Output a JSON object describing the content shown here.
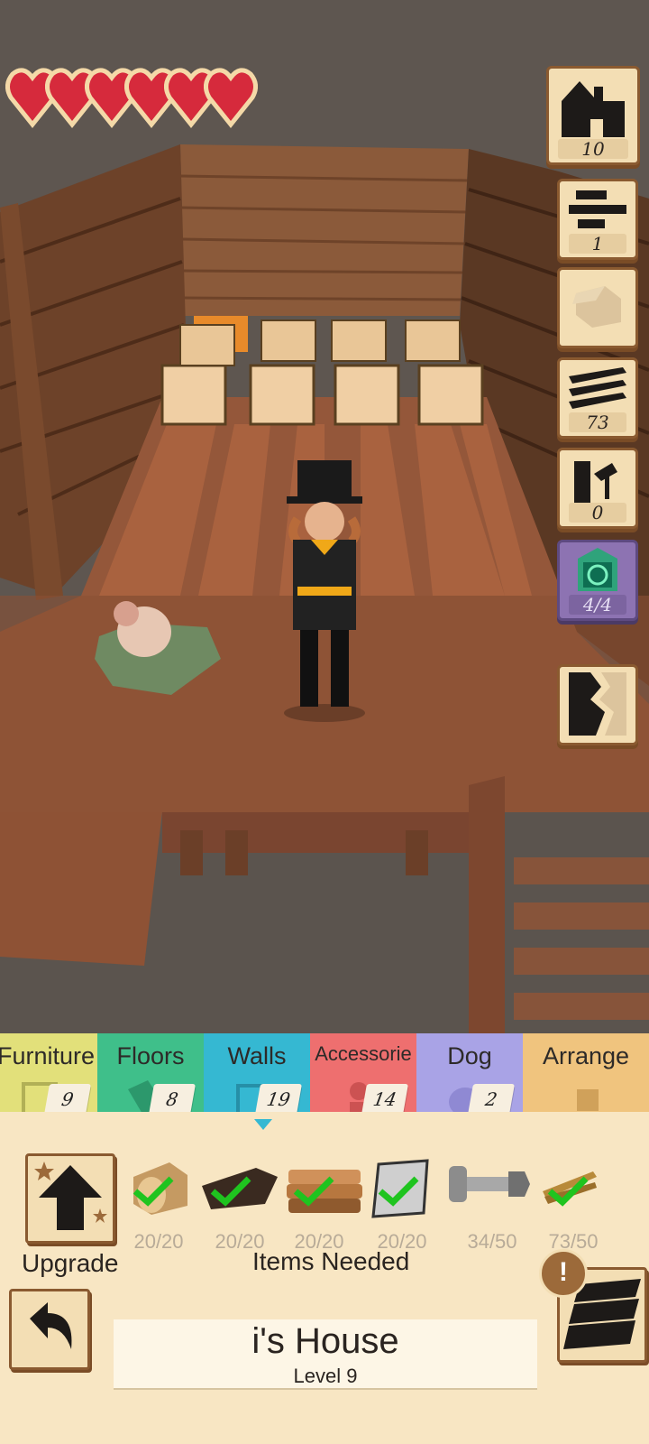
{
  "hearts": {
    "count": 6,
    "color": "#d62a3c"
  },
  "side_buttons": [
    {
      "name": "house",
      "icon": "house-icon",
      "count": "10"
    },
    {
      "name": "walls",
      "icon": "wall-pieces-icon",
      "count": "1"
    },
    {
      "name": "box",
      "icon": "box-icon",
      "count": ""
    },
    {
      "name": "planks",
      "icon": "planks-icon",
      "count": "73"
    },
    {
      "name": "wrecker",
      "icon": "axe-icon",
      "count": "0"
    },
    {
      "name": "portal",
      "icon": "portal-icon",
      "count": "4/4"
    },
    {
      "name": "crack",
      "icon": "crack-icon",
      "count": ""
    }
  ],
  "tabs": [
    {
      "label": "Furniture",
      "count": "9",
      "color": "#e2e07a"
    },
    {
      "label": "Floors",
      "count": "8",
      "color": "#3fbf8a"
    },
    {
      "label": "Walls",
      "count": "19",
      "color": "#35b8d2"
    },
    {
      "label": "Accessorie",
      "count": "14",
      "color": "#ee6f6f"
    },
    {
      "label": "Dog",
      "count": "2",
      "color": "#a9a3e6"
    },
    {
      "label": "Arrange",
      "count": "",
      "color": "#f0c47e"
    }
  ],
  "items": [
    {
      "icon": "log-icon",
      "count": "20/20"
    },
    {
      "icon": "bark-icon",
      "count": "20/20"
    },
    {
      "icon": "planks-stack-icon",
      "count": "20/20"
    },
    {
      "icon": "metal-plate-icon",
      "count": "20/20"
    },
    {
      "icon": "bolt-icon",
      "count": "34/50"
    },
    {
      "icon": "sticks-icon",
      "count": "73/50"
    }
  ],
  "upgrade_label": "Upgrade",
  "items_needed_label": "Items Needed",
  "house": {
    "name": "i's House",
    "level": "Level 9"
  },
  "alert_symbol": "!"
}
